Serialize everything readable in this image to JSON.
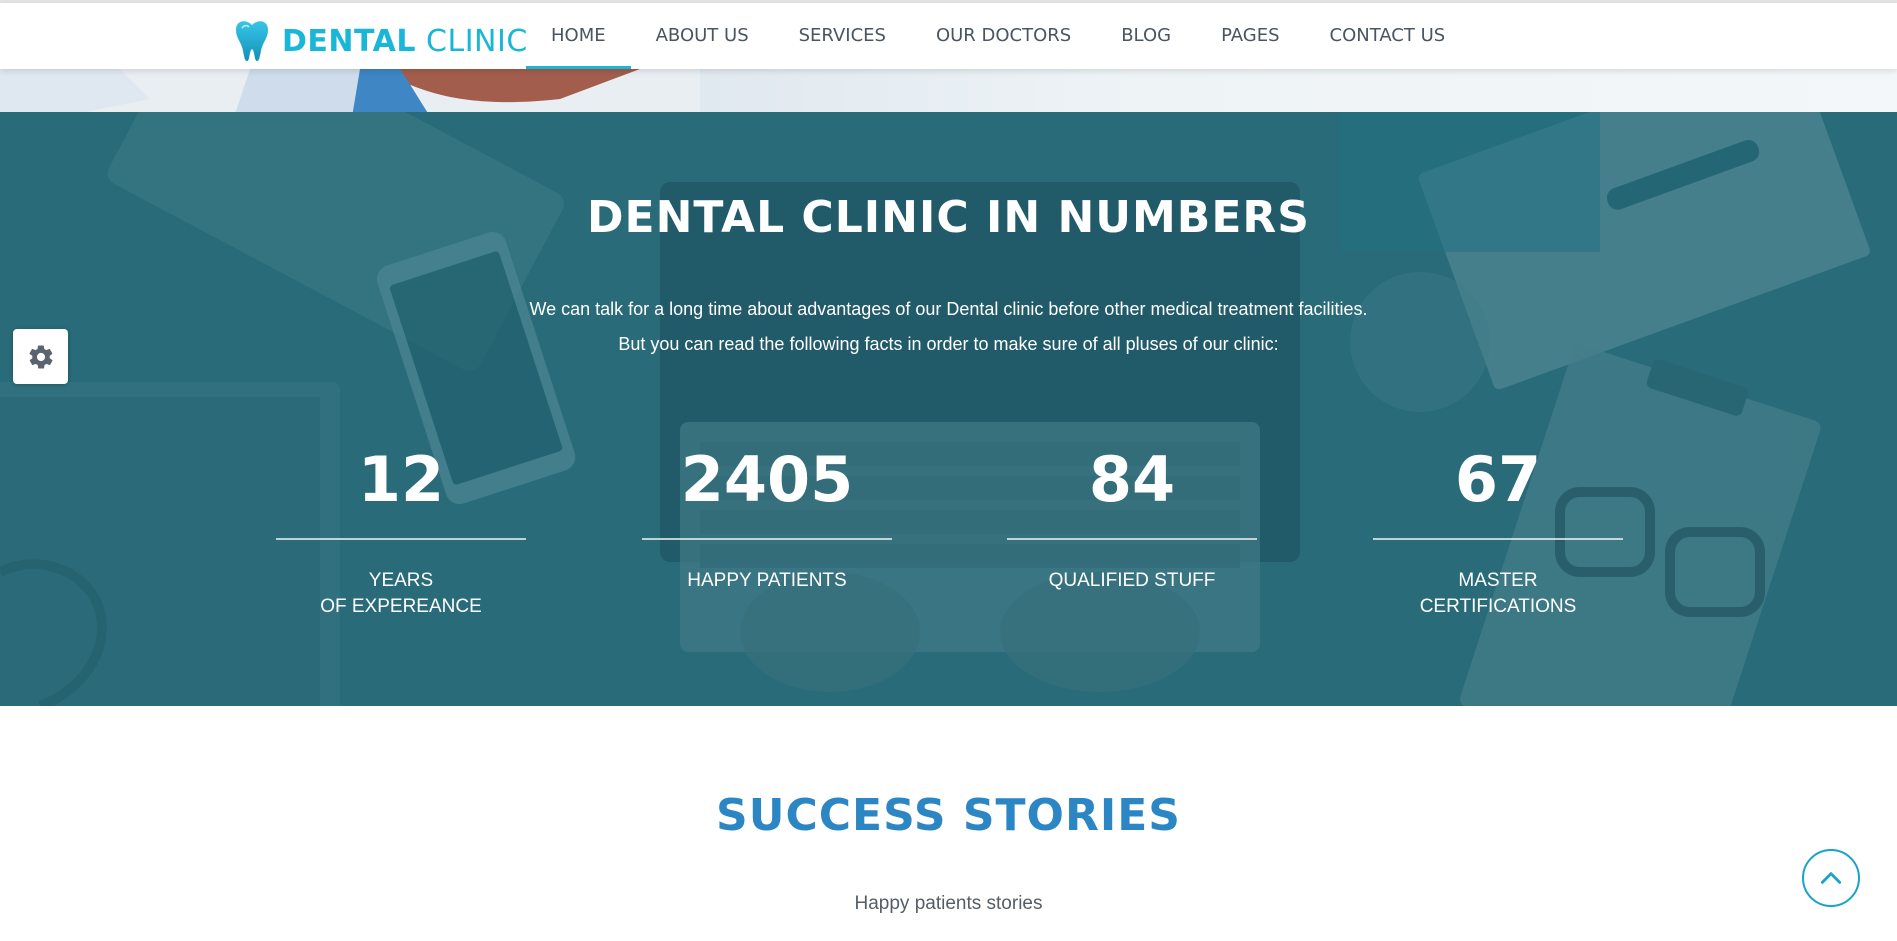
{
  "header": {
    "logo": {
      "word_bold": "DENTAL",
      "word_light": "CLINIC",
      "icon": "tooth-icon"
    },
    "nav": [
      {
        "label": "HOME",
        "active": true
      },
      {
        "label": "ABOUT US",
        "active": false
      },
      {
        "label": "SERVICES",
        "active": false
      },
      {
        "label": "OUR DOCTORS",
        "active": false
      },
      {
        "label": "BLOG",
        "active": false
      },
      {
        "label": "PAGES",
        "active": false
      },
      {
        "label": "CONTACT US",
        "active": false
      }
    ]
  },
  "numbers": {
    "title_bold": "DENTAL CLINIC",
    "title_light": "IN NUMBERS",
    "desc_line1": "We can talk for a long time about advantages of our Dental clinic before other medical treatment facilities.",
    "desc_line2": "But you can read the following facts in order to make sure of all pluses of our clinic:",
    "stats": [
      {
        "value": "12",
        "label_line1": "YEARS",
        "label_line2": "OF EXPEREANCE"
      },
      {
        "value": "2405",
        "label_line1": "HAPPY PATIENTS",
        "label_line2": ""
      },
      {
        "value": "84",
        "label_line1": "QUALIFIED STUFF",
        "label_line2": ""
      },
      {
        "value": "67",
        "label_line1": "MASTER",
        "label_line2": "CERTIFICATIONS"
      }
    ]
  },
  "success": {
    "title_bold": "SUCCESS",
    "title_light": "STORIES",
    "subtitle": "Happy patients stories"
  },
  "widgets": {
    "settings_icon": "gear-icon",
    "scroll_top_icon": "chevron-up-icon"
  },
  "colors": {
    "brand_cyan": "#1ab6d8",
    "success_blue": "#2c86c4",
    "numbers_teal": "#2d6a77",
    "nav_text": "#4a5560"
  }
}
